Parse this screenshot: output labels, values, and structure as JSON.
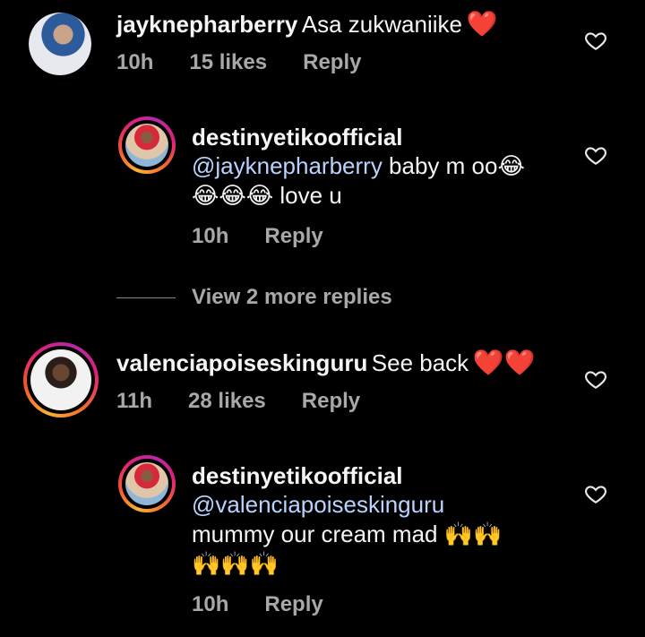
{
  "comments": [
    {
      "username": "jayknepharberry",
      "text": "Asa zukwaniike",
      "emoji": "❤️",
      "time": "10h",
      "likes": "15 likes",
      "reply": "Reply"
    },
    {
      "username": "valenciapoiseskinguru",
      "text": "See back",
      "emoji": "❤️❤️",
      "time": "11h",
      "likes": "28 likes",
      "reply": "Reply"
    }
  ],
  "replies": [
    {
      "username": "destinyetikoofficial",
      "mention": "@jayknepharberry",
      "line1_rest": " baby m oo",
      "line1_emoji": "😂",
      "line2_emoji": "😂😂😂",
      "line2_text": " love u",
      "time": "10h",
      "reply": "Reply"
    },
    {
      "username": "destinyetikoofficial",
      "mention": "@valenciapoiseskinguru",
      "line2_text": "mummy our cream mad ",
      "line2_emoji": "🙌🙌",
      "line3_emoji": "🙌🙌🙌",
      "time": "10h",
      "reply": "Reply"
    }
  ],
  "view_more": "View 2 more replies",
  "colors": {
    "background": "#000000",
    "text": "#f5f5f5",
    "secondary": "#a8a8a8",
    "mention": "#b9d3ff",
    "heart_red": "#e8202a"
  }
}
